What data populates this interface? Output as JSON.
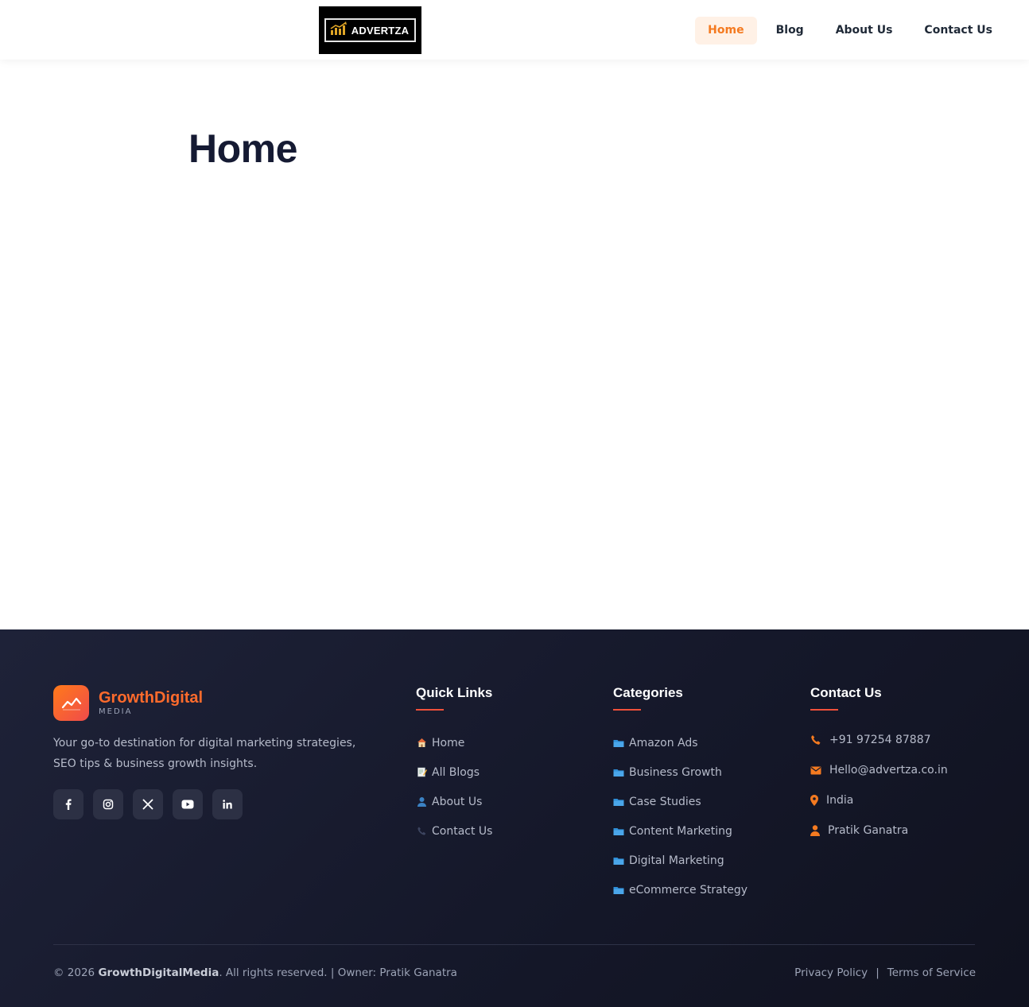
{
  "header": {
    "logo_text": "ADVERTZA",
    "nav": [
      {
        "label": "Home",
        "active": true
      },
      {
        "label": "Blog",
        "active": false
      },
      {
        "label": "About Us",
        "active": false
      },
      {
        "label": "Contact Us",
        "active": false
      }
    ]
  },
  "main": {
    "title": "Home"
  },
  "footer": {
    "brand": {
      "name": "GrowthDigital",
      "sub": "MEDIA",
      "description": "Your go-to destination for digital marketing strategies, SEO tips & business growth insights."
    },
    "socials": [
      {
        "icon": "facebook-icon"
      },
      {
        "icon": "instagram-icon"
      },
      {
        "icon": "x-twitter-icon"
      },
      {
        "icon": "youtube-icon"
      },
      {
        "icon": "linkedin-icon"
      }
    ],
    "quick_links": {
      "title": "Quick Links",
      "items": [
        {
          "icon": "house-emoji-icon",
          "label": "Home"
        },
        {
          "icon": "memo-emoji-icon",
          "label": "All Blogs"
        },
        {
          "icon": "person-emoji-icon",
          "label": "About Us"
        },
        {
          "icon": "telephone-emoji-icon",
          "label": "Contact Us"
        }
      ]
    },
    "categories": {
      "title": "Categories",
      "items": [
        {
          "icon": "folder-icon",
          "label": "Amazon Ads"
        },
        {
          "icon": "folder-icon",
          "label": "Business Growth"
        },
        {
          "icon": "folder-icon",
          "label": "Case Studies"
        },
        {
          "icon": "folder-icon",
          "label": "Content Marketing"
        },
        {
          "icon": "folder-icon",
          "label": "Digital Marketing"
        },
        {
          "icon": "folder-icon",
          "label": "eCommerce Strategy"
        }
      ]
    },
    "contact": {
      "title": "Contact Us",
      "items": [
        {
          "icon": "phone-icon",
          "label": "+91 97254 87887"
        },
        {
          "icon": "envelope-icon",
          "label": "Hello@advertza.co.in"
        },
        {
          "icon": "map-pin-icon",
          "label": "India"
        },
        {
          "icon": "user-icon",
          "label": "Pratik Ganatra"
        }
      ]
    },
    "copyright": {
      "prefix": "© 2026 ",
      "brand": "GrowthDigitalMedia",
      "suffix": ". All rights reserved. | Owner: Pratik Ganatra"
    },
    "legal": {
      "privacy": "Privacy Policy",
      "separator": "|",
      "terms": "Terms of Service"
    }
  },
  "colors": {
    "accent_orange": "#f47a20",
    "footer_bg": "#15182a",
    "title_dark": "#151a33"
  }
}
